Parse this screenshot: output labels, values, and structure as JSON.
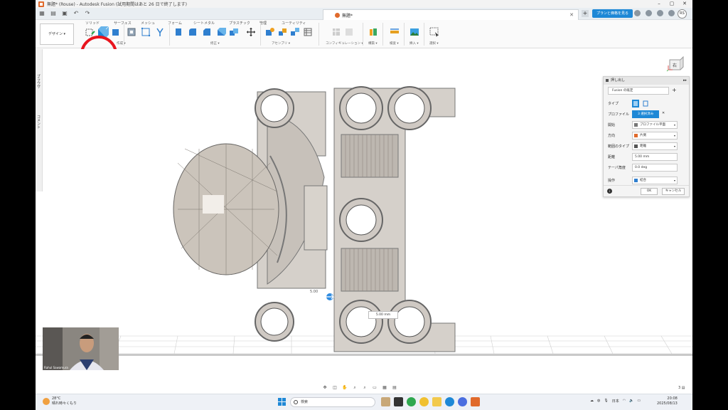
{
  "window": {
    "title": "無題* (Rouse) - Autodesk Fusion (試用期間はあと 26 日で終了します)"
  },
  "tabs": {
    "doc_tab": "無題*",
    "plan_button": "プランと価格を見る",
    "avatar": "RS"
  },
  "ribbon": {
    "design_label": "デザイン ▾",
    "groups": [
      "ソリッド",
      "サーフェス",
      "メッシュ",
      "フォーム",
      "シートメタル",
      "プラスチック",
      "管理",
      "ユーティリティ"
    ],
    "footers": [
      "作成 ▾",
      "修正 ▾",
      "アセンブリ ▾",
      "コンフィギュレーション ▾",
      "構築 ▾",
      "検査 ▾",
      "挿入 ▾",
      "選択 ▾"
    ]
  },
  "side_strip": {
    "items": [
      "ブラウザ",
      "コメント"
    ]
  },
  "dialog": {
    "title": "押し出し",
    "fusion_select": "Fusion の既定",
    "rows": [
      {
        "label": "タイプ"
      },
      {
        "label": "プロファイル",
        "value": "3 選択済み"
      },
      {
        "label": "開始",
        "value": "プロファイル平面"
      },
      {
        "label": "方向",
        "value": "片側"
      },
      {
        "label": "範囲のタイプ",
        "value": "距離"
      },
      {
        "label": "距離",
        "value": "5.00 mm"
      },
      {
        "label": "テーパ角度",
        "value": "0.0 deg"
      },
      {
        "label": "操作",
        "value": "結合"
      }
    ],
    "ok": "OK",
    "cancel": "キャンセル"
  },
  "viewport": {
    "view_cube_label": "右",
    "dimension_box": "5.00 mm",
    "dimension_small": "5.00",
    "page_count": "3 ▤"
  },
  "webcam": {
    "name": "Rahul Sawamura"
  },
  "taskbar": {
    "weather_temp": "28°C",
    "weather_desc": "晴れ時々くもり",
    "search_placeholder": "検索",
    "tray_lang": "日本",
    "time": "20:08",
    "date": "2025/08/13"
  },
  "colors": {
    "accent_blue": "#1e88d6",
    "highlight_red": "#e8141d",
    "model_gray": "#cfcac4"
  }
}
